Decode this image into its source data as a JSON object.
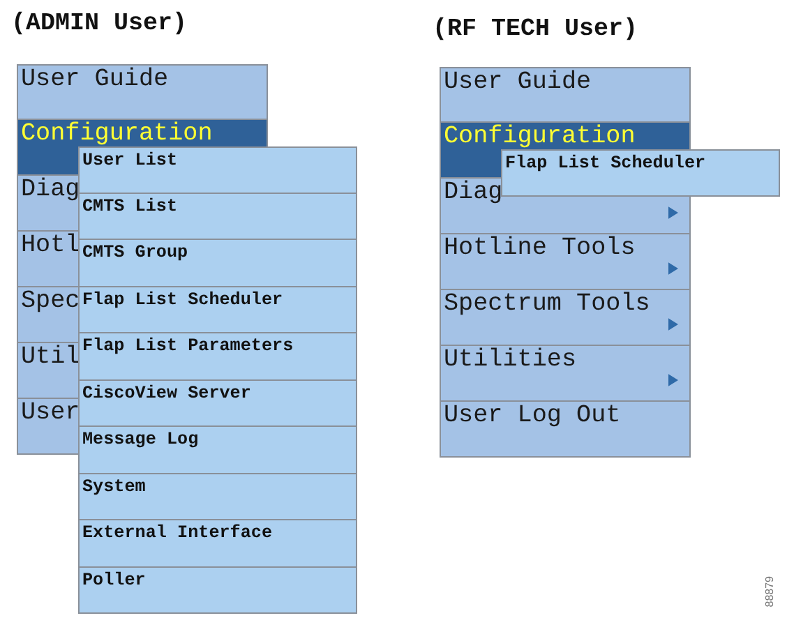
{
  "panels": [
    {
      "title": "(ADMIN User)",
      "menu": [
        {
          "label": "User Guide",
          "selected": false,
          "arrow": false
        },
        {
          "label": "Configuration",
          "selected": true,
          "arrow": false
        },
        {
          "label": "Diag",
          "selected": false,
          "arrow": false
        },
        {
          "label": "Hotl",
          "selected": false,
          "arrow": false
        },
        {
          "label": "Spec",
          "selected": false,
          "arrow": false
        },
        {
          "label": "Util",
          "selected": false,
          "arrow": false
        },
        {
          "label": "User",
          "selected": false,
          "arrow": false
        }
      ],
      "submenu": [
        "User List",
        "CMTS List",
        "CMTS Group",
        "Flap List Scheduler",
        "Flap List Parameters",
        "CiscoView Server",
        "Message Log",
        "System",
        "External Interface",
        "Poller"
      ]
    },
    {
      "title": "(RF TECH User)",
      "menu": [
        {
          "label": "User Guide",
          "selected": false,
          "arrow": false
        },
        {
          "label": "Configuration",
          "selected": true,
          "arrow": false
        },
        {
          "label": "Diag",
          "selected": false,
          "arrow": true
        },
        {
          "label": "Hotline Tools",
          "selected": false,
          "arrow": true
        },
        {
          "label": "Spectrum Tools",
          "selected": false,
          "arrow": true
        },
        {
          "label": "Utilities",
          "selected": false,
          "arrow": true
        },
        {
          "label": "User Log Out",
          "selected": false,
          "arrow": false
        }
      ],
      "submenu": [
        "Flap List Scheduler"
      ]
    }
  ],
  "figure_id": "88879"
}
